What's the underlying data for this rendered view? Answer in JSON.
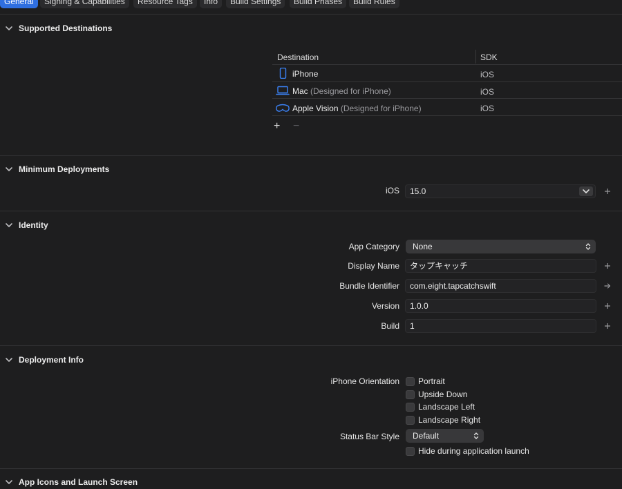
{
  "tabs": [
    {
      "label": "General",
      "active": true
    },
    {
      "label": "Signing & Capabilities",
      "active": false
    },
    {
      "label": "Resource Tags",
      "active": false
    },
    {
      "label": "Info",
      "active": false
    },
    {
      "label": "Build Settings",
      "active": false
    },
    {
      "label": "Build Phases",
      "active": false
    },
    {
      "label": "Build Rules",
      "active": false
    }
  ],
  "sections": {
    "supported_destinations": "Supported Destinations",
    "minimum_deployments": "Minimum Deployments",
    "identity": "Identity",
    "deployment_info": "Deployment Info",
    "app_icons": "App Icons and Launch Screen"
  },
  "destinations": {
    "col_destination": "Destination",
    "col_sdk": "SDK",
    "rows": [
      {
        "name": "iPhone",
        "note": "",
        "sdk": "iOS",
        "icon": "iphone-icon"
      },
      {
        "name": "Mac",
        "note": "(Designed for iPhone)",
        "sdk": "iOS",
        "icon": "laptop-icon"
      },
      {
        "name": "Apple Vision",
        "note": "(Designed for iPhone)",
        "sdk": "iOS",
        "icon": "vision-pro-icon"
      }
    ],
    "add_symbol": "+",
    "remove_symbol": "−"
  },
  "min_deployments": {
    "label": "iOS",
    "value": "15.0"
  },
  "identity": {
    "app_category_label": "App Category",
    "app_category_value": "None",
    "display_name_label": "Display Name",
    "display_name_value": "タップキャッチ",
    "bundle_id_label": "Bundle Identifier",
    "bundle_id_value": "com.eight.tapcatchswift",
    "version_label": "Version",
    "version_value": "1.0.0",
    "build_label": "Build",
    "build_value": "1"
  },
  "deployment_info": {
    "orientation_label": "iPhone Orientation",
    "orientations": [
      {
        "label": "Portrait",
        "checked": false
      },
      {
        "label": "Upside Down",
        "checked": false
      },
      {
        "label": "Landscape Left",
        "checked": false
      },
      {
        "label": "Landscape Right",
        "checked": false
      }
    ],
    "status_bar_label": "Status Bar Style",
    "status_bar_value": "Default",
    "hide_launch_label": "Hide during application launch",
    "hide_launch_checked": false
  },
  "colors": {
    "accent": "#2f6fe0",
    "icon_blue": "#3b82f6",
    "background": "#1e1e1f"
  }
}
